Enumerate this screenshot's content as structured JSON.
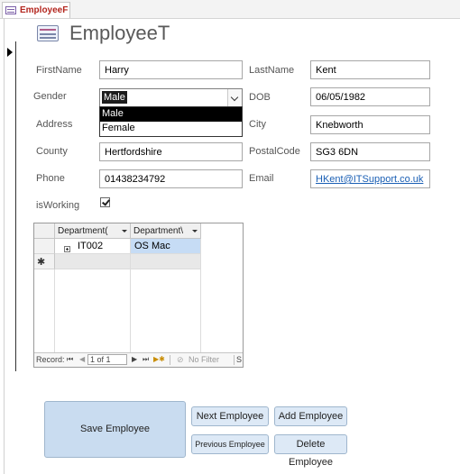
{
  "tab": {
    "label": "EmployeeF",
    "icon": "form-icon"
  },
  "form": {
    "title": "EmployeeT",
    "icon": "form-icon"
  },
  "fields": {
    "firstname": {
      "label": "FirstName",
      "value": "Harry"
    },
    "lastname": {
      "label": "LastName",
      "value": "Kent"
    },
    "gender": {
      "label": "Gender",
      "value": "Male",
      "options": [
        "Male",
        "Female"
      ]
    },
    "dob": {
      "label": "DOB",
      "value": "06/05/1982"
    },
    "address": {
      "label": "Address"
    },
    "city": {
      "label": "City",
      "value": "Knebworth"
    },
    "county": {
      "label": "County",
      "value": "Hertfordshire"
    },
    "postalcode": {
      "label": "PostalCode",
      "value": "SG3 6DN"
    },
    "phone": {
      "label": "Phone",
      "value": "01438234792"
    },
    "email": {
      "label": "Email",
      "value": "HKent@ITSupport.co.uk"
    },
    "isworking": {
      "label": "isWorking",
      "checked": true
    }
  },
  "subform": {
    "columns": [
      "Department(",
      "Department\\"
    ],
    "rows": [
      {
        "dept_id": "IT002",
        "dept_name": "OS Mac"
      }
    ],
    "navigation": {
      "record_label": "Record:",
      "position": "1 of 1",
      "filter_label": "No Filter",
      "search_fragment": "S"
    }
  },
  "buttons": {
    "save": "Save Employee",
    "next": "Next Employee",
    "add": "Add Employee",
    "previous": "Previous Employee",
    "delete": "Delete Employee"
  },
  "colors": {
    "link": "#1a5fb4",
    "selection": "#c6dcf5",
    "button": "#dde9f6",
    "tab_label": "#b3261e"
  }
}
